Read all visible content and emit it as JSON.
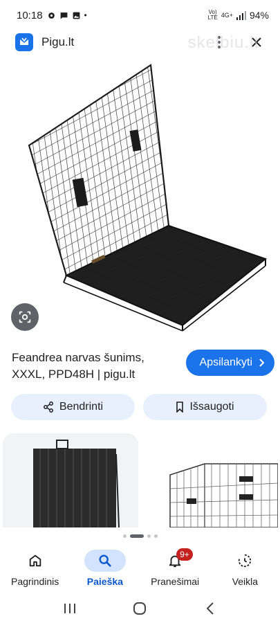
{
  "status_bar": {
    "time": "10:18",
    "battery": "94%",
    "network_top": "Vo)",
    "network_bottom": "LTE",
    "signal_label": "4G+"
  },
  "header": {
    "site_name": "Pigu.lt",
    "watermark": "skelbiu.lt",
    "more_icon": "more-vert-icon",
    "close_icon": "close-icon"
  },
  "result": {
    "title": "Feandrea narvas šunims, XXXL, PPD48H | pigu.lt",
    "visit_label": "Apsilankyti",
    "share_label": "Bendrinti",
    "save_label": "Išsaugoti"
  },
  "bottom_nav": {
    "items": [
      {
        "label": "Pagrindinis",
        "icon": "home-icon"
      },
      {
        "label": "Paieška",
        "icon": "search-icon"
      },
      {
        "label": "Pranešimai",
        "icon": "bell-icon",
        "badge": "9+"
      },
      {
        "label": "Veikla",
        "icon": "activity-icon"
      }
    ]
  },
  "colors": {
    "accent": "#1a73e8",
    "pill_bg": "#e8f0fe",
    "active_nav_bg": "#d3e3fd",
    "badge": "#c5221f"
  }
}
